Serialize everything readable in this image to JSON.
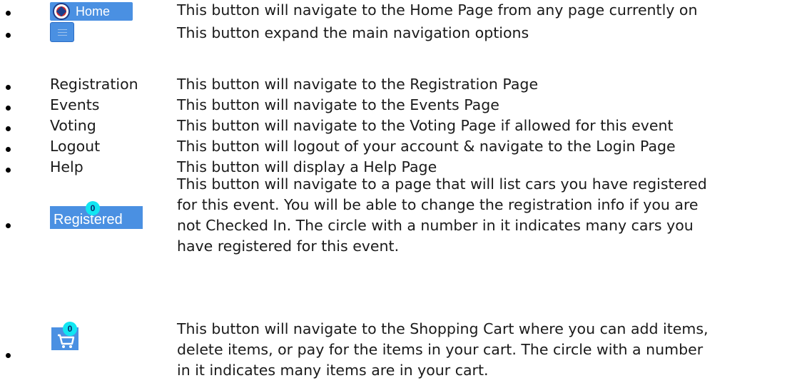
{
  "items": [
    {
      "kind": "home-button",
      "button_text": "Home",
      "description": [
        "This button will navigate to the Home Page from any page currently on"
      ]
    },
    {
      "kind": "menu-button",
      "description": [
        "This button expand the main navigation options"
      ]
    },
    {
      "kind": "text",
      "label": "Registration",
      "description": [
        "This button will navigate to the Registration Page"
      ]
    },
    {
      "kind": "text",
      "label": "Events",
      "description": [
        "This button will navigate to the Events Page"
      ]
    },
    {
      "kind": "text",
      "label": "Voting",
      "description": [
        "This button will navigate to the Voting Page if allowed for this event"
      ]
    },
    {
      "kind": "text",
      "label": "Logout",
      "description": [
        "This button will logout of your account & navigate to the Login Page"
      ]
    },
    {
      "kind": "text",
      "label": "Help",
      "description": [
        "This button will display a Help Page"
      ]
    },
    {
      "kind": "registered-button",
      "button_text": "Registered",
      "badge": "0",
      "description": [
        "This button will navigate to a page that will list cars you have registered",
        "for this event.  You will be able to change the registration info if you are",
        "not Checked In.  The circle with a number in it indicates many cars you",
        "have registered for this event."
      ]
    },
    {
      "kind": "cart-button",
      "badge": "0",
      "description": [
        "This button will navigate to the Shopping Cart where you can add items,",
        "delete items,  or pay for the items in your cart.  The circle with a number",
        "in it indicates many items are in your cart."
      ]
    }
  ],
  "icons": {
    "home_logo": "club-logo-icon",
    "menu": "hamburger-menu-icon",
    "cart": "shopping-cart-icon"
  },
  "colors": {
    "button_blue": "#4a90e2",
    "badge_cyan": "#11e6f2"
  }
}
